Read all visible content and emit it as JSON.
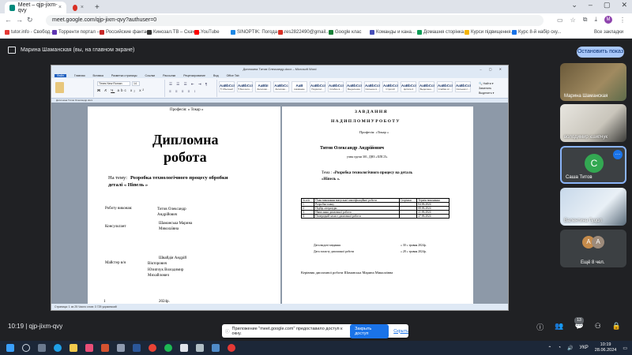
{
  "browser": {
    "tab_title": "Meet – qjp-jixm-qvy",
    "url": "meet.google.com/qjp-jixm-qvy?authuser=0",
    "bookmarks": [
      {
        "label": "tutor.info - Свобод...",
        "color": "#e53935"
      },
      {
        "label": "Торренти портал –...",
        "color": "#5e35b1"
      },
      {
        "label": "Российские фантас...",
        "color": "#c62828"
      },
      {
        "label": "Кинозал.ТВ – Скача...",
        "color": "#333333"
      },
      {
        "label": "YouTube",
        "color": "#ff0000"
      },
      {
        "label": "SINOPTIK: Погода в...",
        "color": "#1e88e5"
      },
      {
        "label": "res2822490@gmail...",
        "color": "#d93025"
      },
      {
        "label": "Google клас",
        "color": "#188038"
      },
      {
        "label": "Команды и кана...",
        "color": "#464eb8"
      },
      {
        "label": "Домашня сторінка...",
        "color": "#0f9d58"
      },
      {
        "label": "Курси підвищення...",
        "color": "#f4b400"
      },
      {
        "label": "Курс 8-й набір ску...",
        "color": "#1a73e8"
      }
    ],
    "all_bookmarks": "Все закладки"
  },
  "meet": {
    "presenting_label": "Марина Шаманская (вы, на главном экране)",
    "stop_button": "Остановить показ",
    "time_code": "10:19  |  qjp-jixm-qvy",
    "participants_count": "13",
    "participants": [
      {
        "name": "Марина Шаманская"
      },
      {
        "name": "володимир юзипчук"
      },
      {
        "name": "Саша Титов",
        "avatar": "С"
      },
      {
        "name": "Валентина Гуцол"
      },
      {
        "name": "Ещё 8 чел.",
        "avatars": [
          "A",
          "A"
        ]
      }
    ],
    "notification": {
      "text": "Приложение \"meet.google.com\" предоставило доступ к окну.",
      "close_button": "Закрыть доступ",
      "hide_link": "Скрыть"
    }
  },
  "word": {
    "window_title": "Дипломна Титов Олександр.docx – Microsoft Word",
    "ribbon_tabs": [
      "Файл",
      "Главная",
      "Вставка",
      "Разметка страницы",
      "Ссылки",
      "Рассылки",
      "Рецензирование",
      "Вид",
      "Office Tab"
    ],
    "font_name": "Times New Roman",
    "font_size": "14",
    "styles": [
      {
        "preview": "AaBbCcI",
        "name": "¶ Обычный"
      },
      {
        "preview": "AaBbCcI",
        "name": "¶ Без инте..."
      },
      {
        "preview": "AaBbI",
        "name": "Заголово..."
      },
      {
        "preview": "AaBbCc",
        "name": "Заголово..."
      },
      {
        "preview": "AaB",
        "name": "Название"
      },
      {
        "preview": "AaBbCcI",
        "name": "Подзагол..."
      },
      {
        "preview": "AaBbCcI",
        "name": "Слабое в..."
      },
      {
        "preview": "AaBbCcI",
        "name": "Выделение"
      },
      {
        "preview": "AaBbCcI",
        "name": "Сильное в..."
      },
      {
        "preview": "AaBbCcI",
        "name": "Строгий"
      },
      {
        "preview": "AaBbCcI",
        "name": "Цитата 2"
      },
      {
        "preview": "AaBbCcI",
        "name": "Выделенн..."
      },
      {
        "preview": "AaBbCcI",
        "name": "Слабая сс..."
      },
      {
        "preview": "AaBbCcI",
        "name": "Сильная с..."
      }
    ],
    "doc_tab": "Дипломна Титов Олександр.docx",
    "status": "Страница: 1 из 25   Число слов: 3 725   украинский",
    "page1": {
      "profession": "Професія: « Токар »",
      "title_line1": "Дипломна",
      "title_line2": "робота",
      "theme_prefix": "На тему:",
      "theme_line1": "Розробка  технологічного процесу обробки",
      "theme_line2": "деталі « Ніпель »",
      "executed_label": "Роботу виконав:",
      "executed_name": "Титов     Олександр",
      "executed_name2": "Андрійович",
      "consultant_label": "Консультант",
      "consultant_name": "Шаманська Марина",
      "consultant_name2": "Миколаївна",
      "master_label": "Майстер в/н",
      "master_name1": "Швайдія          Андрій",
      "master_name2": "Вікторович",
      "master_name3": "Юзипчук Володимир",
      "master_name4": "Михайлович",
      "year": "2024р.",
      "page_num": "1"
    },
    "page2": {
      "heading1": "З А В Д А Н Н Я",
      "heading2": "Н А   Д И П Л О М Н У   Р О Б О Т У",
      "profession": "Професія: «Токар »",
      "student": "Титов Олександр  Андрійович",
      "group": "учня групи 301, ДНЗ «ХПСЛ»",
      "theme_prefix": "Тема : «",
      "theme_line1": "Розробка технологічного процесу на деталь",
      "theme_line2": "«Ніпель ».",
      "table_header": [
        "№ п/п",
        "План виконання випускної кваліфікаційної роботи",
        "Сторінки",
        "Термін виконання"
      ],
      "table_rows": [
        [
          "1.",
          "Розробка плану",
          "",
          "04.06.2024"
        ],
        [
          "2.",
          "Підбір літератури",
          "",
          "08.06.2024"
        ],
        [
          "3.",
          "Написання дипломної роботи",
          "",
          "21.06.2024"
        ],
        [
          "4.",
          "Попередній захист дипломної роботи",
          "",
          "27.06.2024"
        ]
      ],
      "issue_date_label": "Дата видачі завдання",
      "issue_date": "« 30 »   травня  2024р.",
      "submit_date_label": "Дата захисту дипломної роботи",
      "submit_date": "« 28 »   травня  2024р.",
      "supervisor": "Керівник дипломної роботи     Шаманська Марина Миколаївна"
    }
  },
  "taskbar": {
    "lang": "УКР",
    "time": "10:19",
    "date": "28.06.2024"
  }
}
